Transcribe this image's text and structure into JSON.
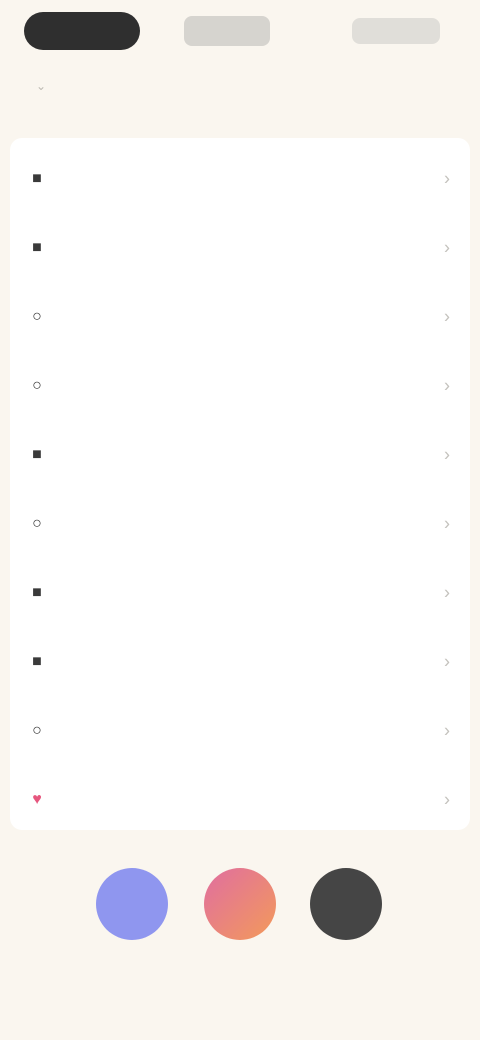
{
  "header": {
    "tab_active": "",
    "tab_secondary": "",
    "action_right": "",
    "collapse_mark": "⌄"
  },
  "menu": {
    "items": [
      {
        "label": "",
        "icon": "square-icon"
      },
      {
        "label": "",
        "icon": "square-icon"
      },
      {
        "label": "",
        "icon": "circle-icon"
      },
      {
        "label": "",
        "icon": "circle-icon"
      },
      {
        "label": "",
        "icon": "square-icon"
      },
      {
        "label": "",
        "icon": "circle-icon"
      },
      {
        "label": "",
        "icon": "square-icon"
      },
      {
        "label": "",
        "icon": "square-icon"
      },
      {
        "label": "",
        "icon": "circle-icon"
      },
      {
        "label": "",
        "icon": "heart-icon",
        "danger": true
      }
    ],
    "chevron": "›"
  },
  "avatars": {
    "a1": "",
    "a2": "",
    "a3": "",
    "caption": ""
  },
  "colors": {
    "background": "#faf6ef",
    "card": "#ffffff",
    "accent_danger": "#e6567e",
    "avatar_blue": "#8f96ef",
    "avatar_dark": "#454545"
  }
}
